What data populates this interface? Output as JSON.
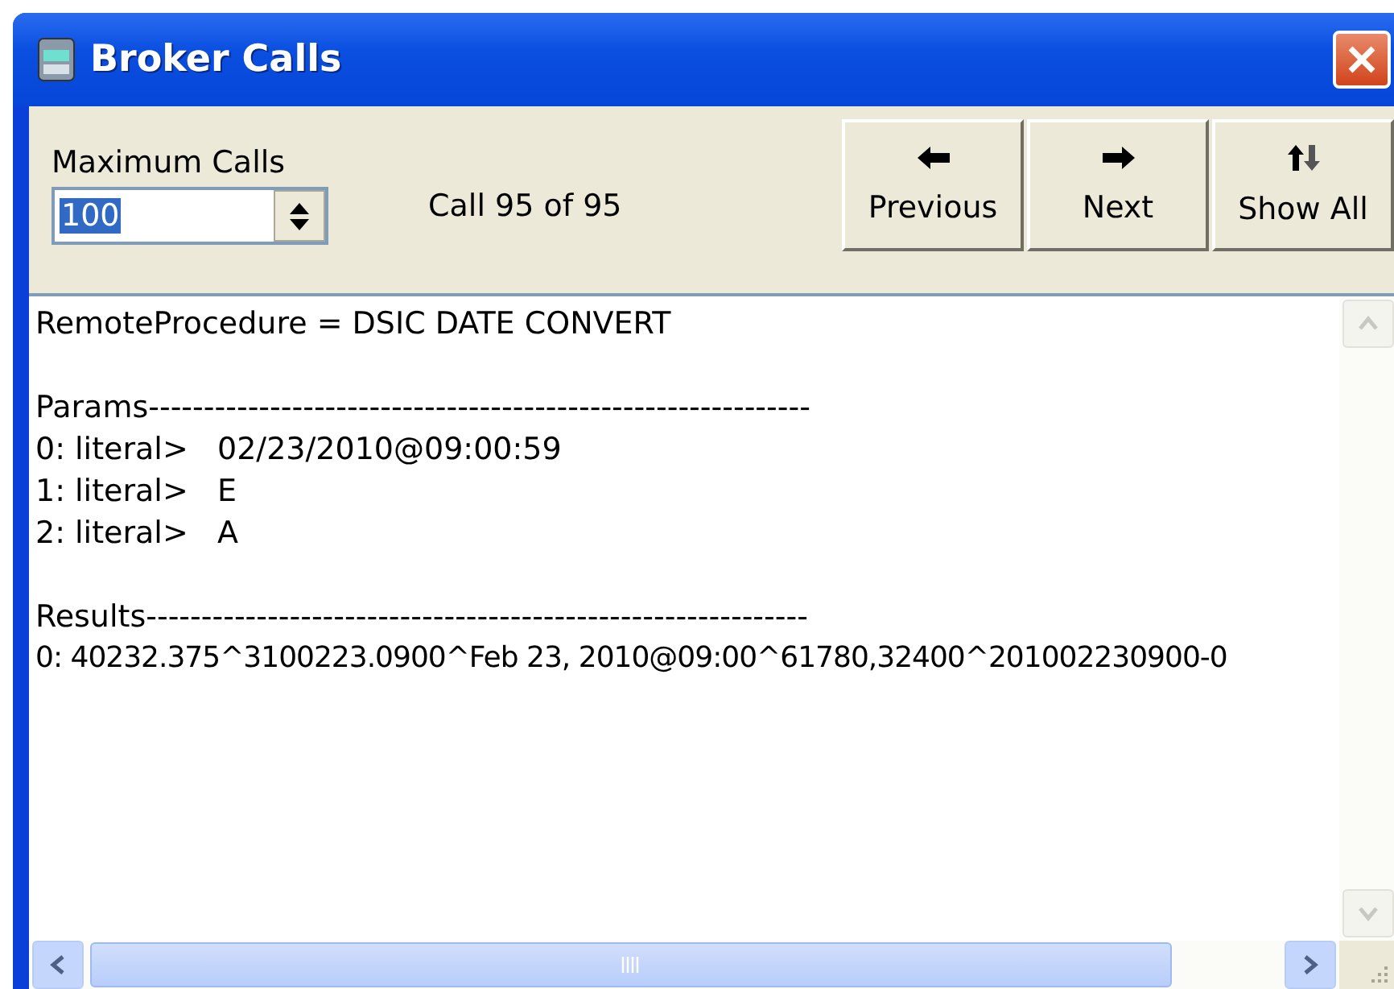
{
  "window": {
    "title": "Broker Calls"
  },
  "toolbar": {
    "max_calls_label": "Maximum Calls",
    "max_calls_value": "100",
    "call_position": "Call 95 of 95",
    "buttons": [
      {
        "kind": "left",
        "label": "Previous"
      },
      {
        "kind": "right",
        "label": "Next"
      },
      {
        "kind": "updown",
        "label": "Show All"
      }
    ]
  },
  "output": {
    "procedure": "RemoteProcedure = DSIC DATE CONVERT",
    "params": {
      "heading": "Params------------------------------------------------------------",
      "lines": [
        "0: literal>   02/23/2010@09:00:59",
        "1: literal>   E",
        "2: literal>   A"
      ]
    },
    "results": {
      "heading": "Results------------------------------------------------------------",
      "lines": [
        "0: 40232.375^3100223.0900^Feb 23, 2010@09:00^61780,32400^201002230900-0"
      ]
    }
  }
}
